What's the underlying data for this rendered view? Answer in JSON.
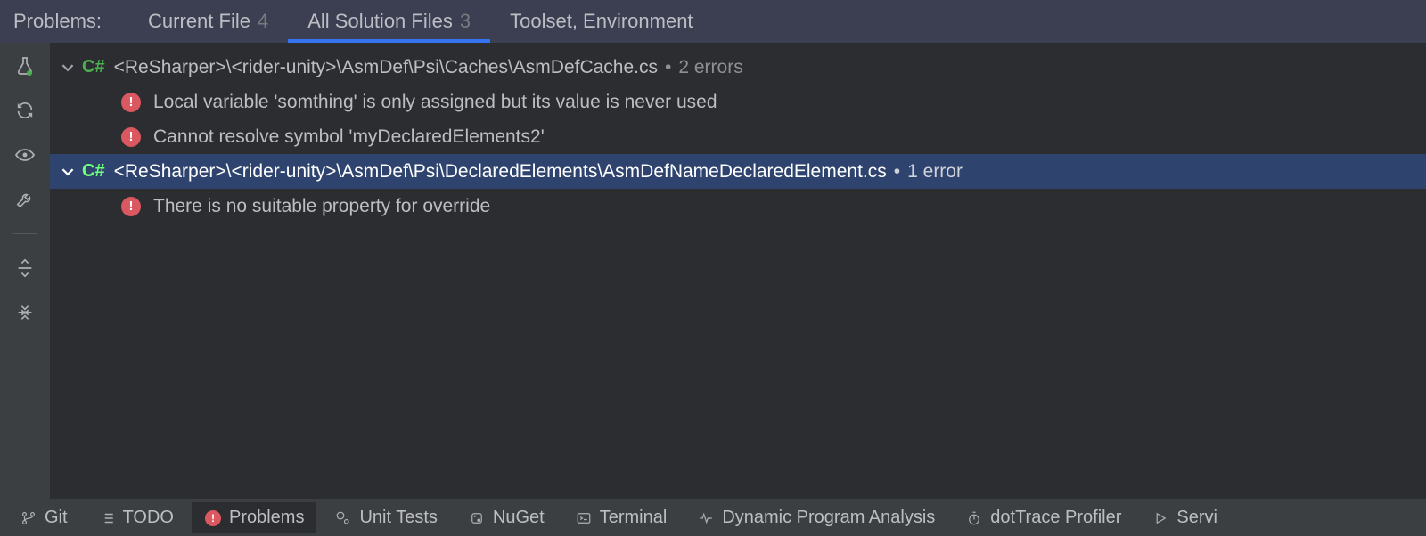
{
  "tabs": {
    "title": "Problems:",
    "items": [
      {
        "label": "Current File",
        "count": "4",
        "active": false
      },
      {
        "label": "All Solution Files",
        "count": "3",
        "active": true
      },
      {
        "label": "Toolset, Environment",
        "count": "",
        "active": false
      }
    ]
  },
  "gutter_icons": [
    "flask-icon",
    "refresh-icon",
    "preview-icon",
    "wrench-icon",
    "separator",
    "expand-all-icon",
    "collapse-all-icon"
  ],
  "tree": [
    {
      "lang": "C#",
      "path": "<ReSharper>\\<rider-unity>\\AsmDef\\Psi\\Caches\\AsmDefCache.cs",
      "summary": "2 errors",
      "selected": false,
      "errors": [
        "Local variable 'somthing' is only assigned but its value is never used",
        "Cannot resolve symbol 'myDeclaredElements2'"
      ]
    },
    {
      "lang": "C#",
      "path": "<ReSharper>\\<rider-unity>\\AsmDef\\Psi\\DeclaredElements\\AsmDefNameDeclaredElement.cs",
      "summary": "1 error",
      "selected": true,
      "errors": [
        "There is no suitable property for override"
      ]
    }
  ],
  "bottom": [
    {
      "icon": "git-branch-icon",
      "label": "Git",
      "active": false
    },
    {
      "icon": "list-icon",
      "label": "TODO",
      "active": false
    },
    {
      "icon": "error-badge-icon",
      "label": "Problems",
      "active": true
    },
    {
      "icon": "beaker-icon",
      "label": "Unit Tests",
      "active": false
    },
    {
      "icon": "package-icon",
      "label": "NuGet",
      "active": false
    },
    {
      "icon": "terminal-icon",
      "label": "Terminal",
      "active": false
    },
    {
      "icon": "pulse-icon",
      "label": "Dynamic Program Analysis",
      "active": false
    },
    {
      "icon": "stopwatch-icon",
      "label": "dotTrace Profiler",
      "active": false
    },
    {
      "icon": "play-icon",
      "label": "Servi",
      "active": false
    }
  ]
}
